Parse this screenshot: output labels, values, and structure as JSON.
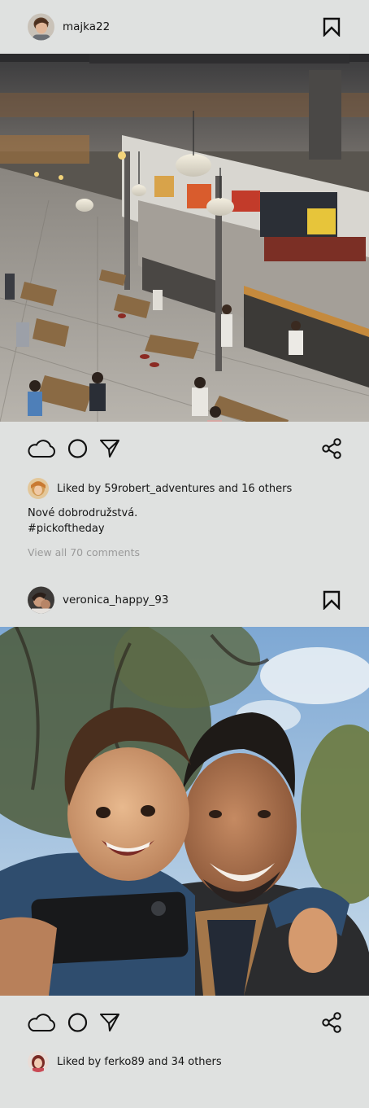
{
  "posts": [
    {
      "username": "majka22",
      "photo_alt": "Food court interior",
      "likes_text": "Liked by 59robert_adventures and 16 others",
      "caption_line1": "Nové dobrodružstvá.",
      "caption_line2": "#pickoftheday",
      "comments_link": "View all 70 comments"
    },
    {
      "username": "veronica_happy_93",
      "photo_alt": "Father and son selfie",
      "likes_text": "Liked by ferko89 and 34 others"
    }
  ],
  "icons": {
    "like": "cloud-icon",
    "comment": "circle-icon",
    "share_direct": "send-triangle-icon",
    "share": "share-nodes-icon",
    "bookmark": "bookmark-icon"
  }
}
